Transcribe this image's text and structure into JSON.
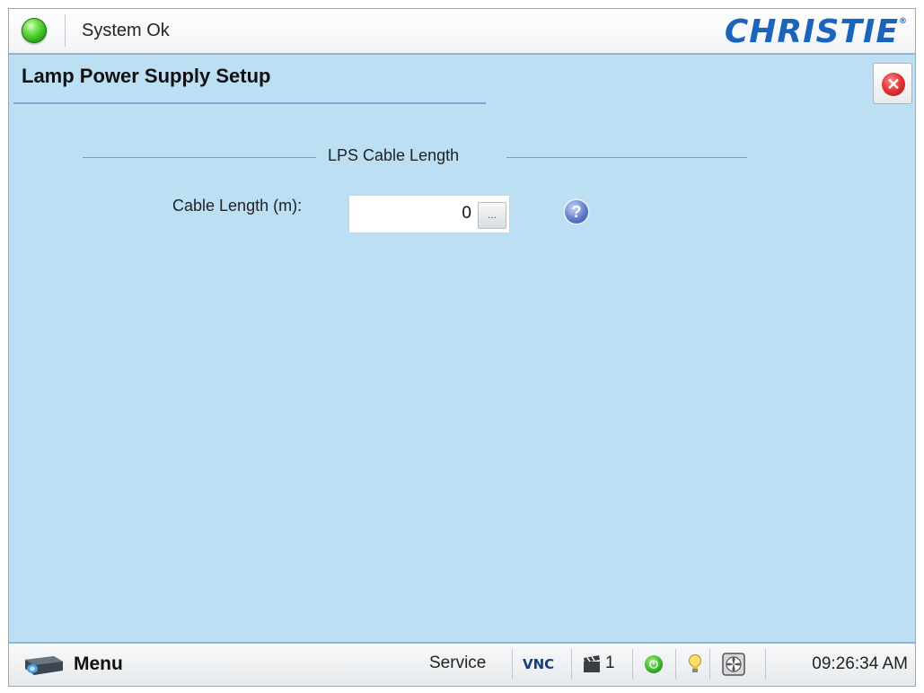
{
  "header": {
    "status_text": "System Ok",
    "brand": "CHRISTIE"
  },
  "page": {
    "title": "Lamp Power Supply Setup"
  },
  "section": {
    "title": "LPS Cable Length",
    "field_label": "Cable Length (m):",
    "field_value": "0",
    "ellipsis_label": "..."
  },
  "footer": {
    "menu_label": "Menu",
    "access_level": "Service",
    "vnc_label": "VNC",
    "channel_number": "1",
    "time": "09:26:34 AM"
  },
  "colors": {
    "background": "#bcdff4",
    "brand": "#1a64bb",
    "status_ok": "#2fb01d",
    "close": "#d52a2a"
  },
  "icons": {
    "status": "green-status-led-icon",
    "close": "close-icon",
    "help": "help-icon",
    "menu": "projector-icon",
    "channel": "clapperboard-icon",
    "power": "power-icon",
    "lamp": "lightbulb-icon",
    "fan": "fan-icon"
  }
}
